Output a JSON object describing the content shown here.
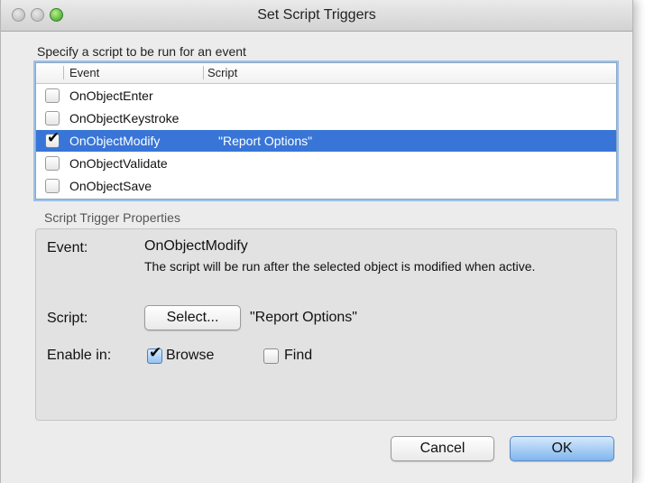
{
  "window": {
    "title": "Set Script Triggers"
  },
  "list": {
    "caption": "Specify a script to be run for an event",
    "columns": [
      "Event",
      "Script"
    ],
    "rows": [
      {
        "event": "OnObjectEnter",
        "script": "",
        "checked": false,
        "selected": false
      },
      {
        "event": "OnObjectKeystroke",
        "script": "",
        "checked": false,
        "selected": false
      },
      {
        "event": "OnObjectModify",
        "script": "\"Report Options\"",
        "checked": true,
        "selected": true
      },
      {
        "event": "OnObjectValidate",
        "script": "",
        "checked": false,
        "selected": false
      },
      {
        "event": "OnObjectSave",
        "script": "",
        "checked": false,
        "selected": false
      }
    ]
  },
  "properties": {
    "caption": "Script Trigger Properties",
    "event_label": "Event:",
    "event_value": "OnObjectModify",
    "event_description": "The script will be run after the selected object is modified when active.",
    "script_label": "Script:",
    "select_button": "Select...",
    "script_value": "\"Report Options\"",
    "enable_label": "Enable in:",
    "browse_label": "Browse",
    "browse_checked": true,
    "find_label": "Find",
    "find_checked": false
  },
  "buttons": {
    "cancel": "Cancel",
    "ok": "OK"
  },
  "colors": {
    "selection": "#3875d7",
    "ok_button": "#7fb6ee"
  },
  "icons": {
    "check": "checkmark-icon"
  }
}
